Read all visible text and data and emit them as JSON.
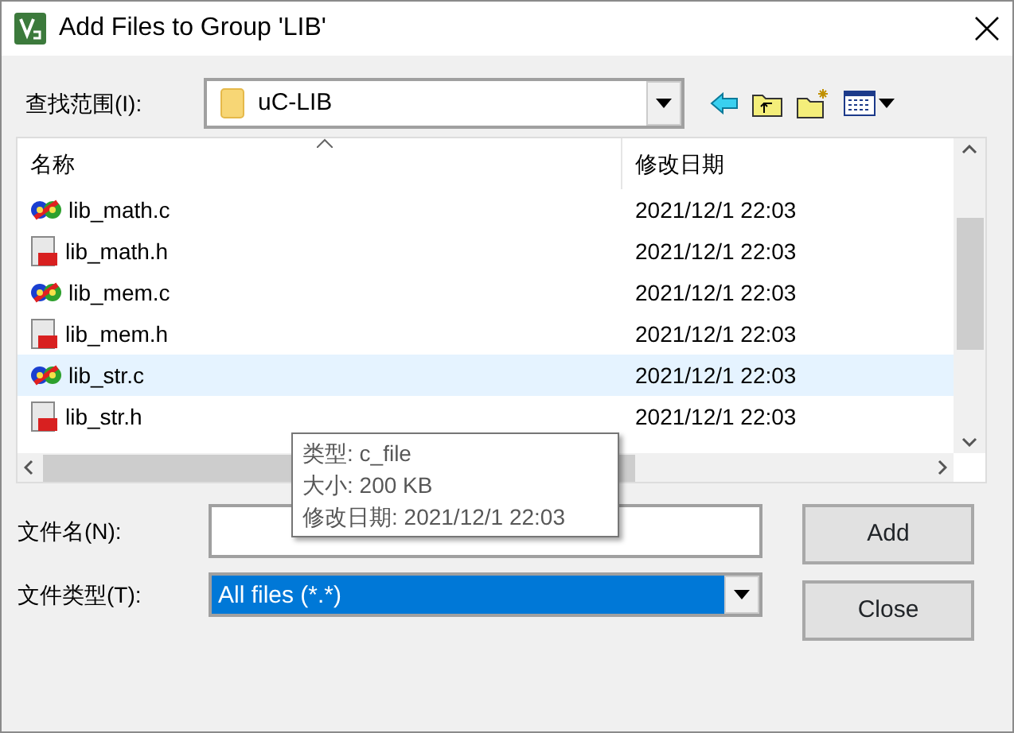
{
  "window": {
    "title": "Add Files to Group 'LIB'"
  },
  "look_in": {
    "label": "查找范围(I):",
    "value": "uC-LIB"
  },
  "file_list": {
    "columns": [
      "名称",
      "修改日期"
    ],
    "rows": [
      {
        "name": "lib_math.c",
        "kind": "c",
        "modified": "2021/12/1 22:03",
        "selected": false
      },
      {
        "name": "lib_math.h",
        "kind": "h",
        "modified": "2021/12/1 22:03",
        "selected": false
      },
      {
        "name": "lib_mem.c",
        "kind": "c",
        "modified": "2021/12/1 22:03",
        "selected": false
      },
      {
        "name": "lib_mem.h",
        "kind": "h",
        "modified": "2021/12/1 22:03",
        "selected": false
      },
      {
        "name": "lib_str.c",
        "kind": "c",
        "modified": "2021/12/1 22:03",
        "selected": true
      },
      {
        "name": "lib_str.h",
        "kind": "h",
        "modified": "2021/12/1 22:03",
        "selected": false
      }
    ]
  },
  "tooltip": {
    "lines": [
      "类型: c_file",
      "大小: 200 KB",
      "修改日期: 2021/12/1 22:03"
    ]
  },
  "file_name": {
    "label": "文件名(N):"
  },
  "file_type": {
    "label": "文件类型(T):",
    "value": "All files (*.*)"
  },
  "buttons": [
    "Add",
    "Close"
  ]
}
